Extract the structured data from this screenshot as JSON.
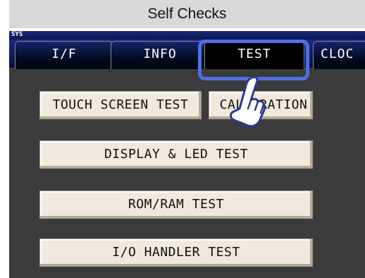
{
  "title": "Self Checks",
  "system_label": "SYS",
  "tabs": [
    {
      "label": "I/F"
    },
    {
      "label": "INFO"
    },
    {
      "label": "TEST"
    },
    {
      "label": "CLOC"
    }
  ],
  "buttons": {
    "touch_screen": "TOUCH SCREEN TEST",
    "calibration": "CALIBRATION",
    "display_led": "DISPLAY & LED TEST",
    "rom_ram": "ROM/RAM TEST",
    "io_handler": "I/O HANDLER TEST"
  },
  "colors": {
    "highlight": "#4f6fe6",
    "tab_bar": "#0b1550",
    "panel": "#3b3b3b",
    "button": "#f1e9dc"
  },
  "icons": {
    "pointer": "pointing-hand-icon"
  }
}
